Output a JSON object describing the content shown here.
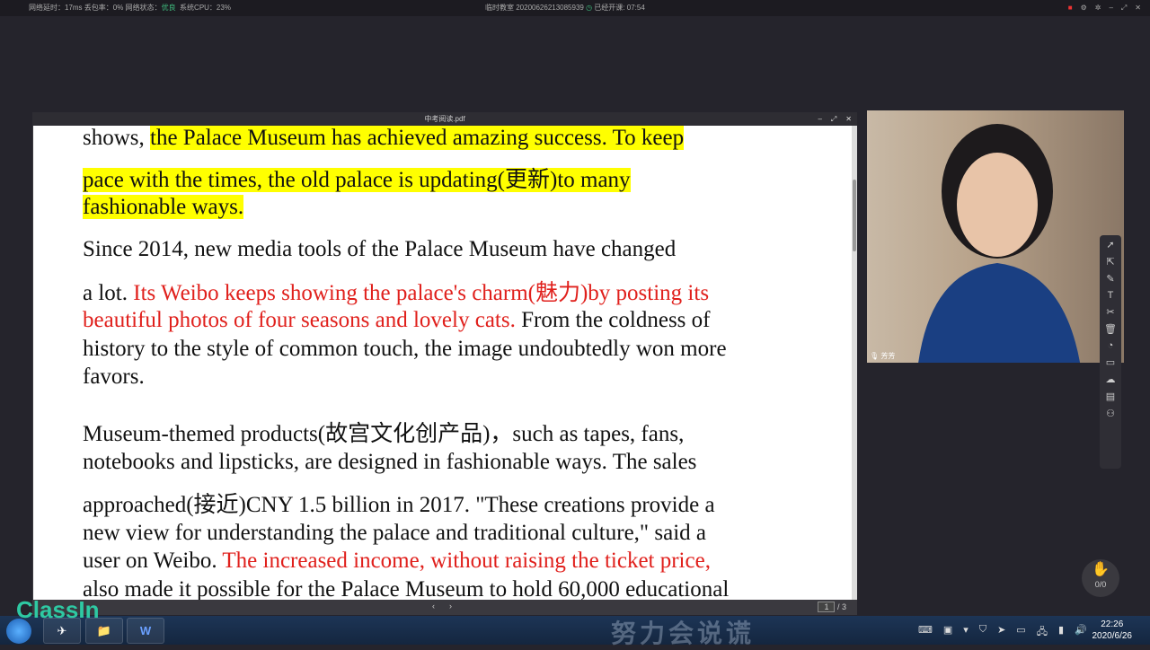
{
  "status_bar": {
    "latency": "网络延时：17ms",
    "loss": "丢包率：0%",
    "net_label": "网络状态：",
    "net_value": "优良",
    "cpu": "系统CPU：23%",
    "classroom": "临时教室 2020062621308593​9",
    "elapsed": "已经开课: 07:54",
    "controls": [
      "record-icon",
      "gear-icon",
      "pin-icon",
      "minimize-icon",
      "maximize-icon",
      "close-icon"
    ]
  },
  "pdf": {
    "title": "中考阅读.pdf",
    "page": "1",
    "total": "/ 3",
    "lines": [
      [
        {
          "t": "shows, "
        },
        {
          "t": "the Palace Museum has achieved amazing success.  To keep",
          "s": "hl"
        }
      ],
      [
        {
          "t": "pace with the times, the old palace is updating(更新)to many",
          "s": "hl"
        }
      ],
      [
        {
          "t": "fashionable ways.",
          "s": "hl"
        }
      ],
      [
        {
          "t": "     Since 2014, new media tools of the Palace Museum have changed"
        }
      ],
      [
        {
          "t": "a lot. "
        },
        {
          "t": "Its Weibo keeps showing the palace's charm(魅力)by posting its",
          "s": "red"
        }
      ],
      [
        {
          "t": "beautiful photos of four seasons and lovely cats.",
          "s": "red"
        },
        {
          "t": " From the coldness of"
        }
      ],
      [
        {
          "t": "history to the style of common touch, the image undoubtedly won more"
        }
      ],
      [
        {
          "t": "favors."
        }
      ],
      [
        {
          "t": "      Museum-themed products(故宫文化创产品)，such as tapes, fans,"
        }
      ],
      [
        {
          "t": "notebooks and lipsticks, are designed in fashionable ways. The sales"
        }
      ],
      [
        {
          "t": "approached(接近)CNY 1.5 billion in 2017. \"These creations provide a"
        }
      ],
      [
        {
          "t": "new view for understanding the palace and traditional culture,\" said a"
        }
      ],
      [
        {
          "t": "user on Weibo. "
        },
        {
          "t": "The increased income, without raising the ticket price,",
          "s": "red"
        }
      ],
      [
        {
          "t": "also made it possible for the Palace Museum to hold 60,000 educational"
        }
      ]
    ]
  },
  "video": {
    "name": "芳芳"
  },
  "tools": [
    "pointer-icon",
    "select-icon",
    "pen-icon",
    "text-icon",
    "scissors-icon",
    "trash-icon",
    "timer-icon",
    "chat-icon",
    "cloud-icon",
    "toolbox-icon",
    "users-icon"
  ],
  "hand": {
    "count": "0/0"
  },
  "logo": "ClassIn",
  "watermark": "努力会说谎",
  "taskbar": {
    "time": "22:26",
    "date": "2020/6/26",
    "word": "W"
  }
}
